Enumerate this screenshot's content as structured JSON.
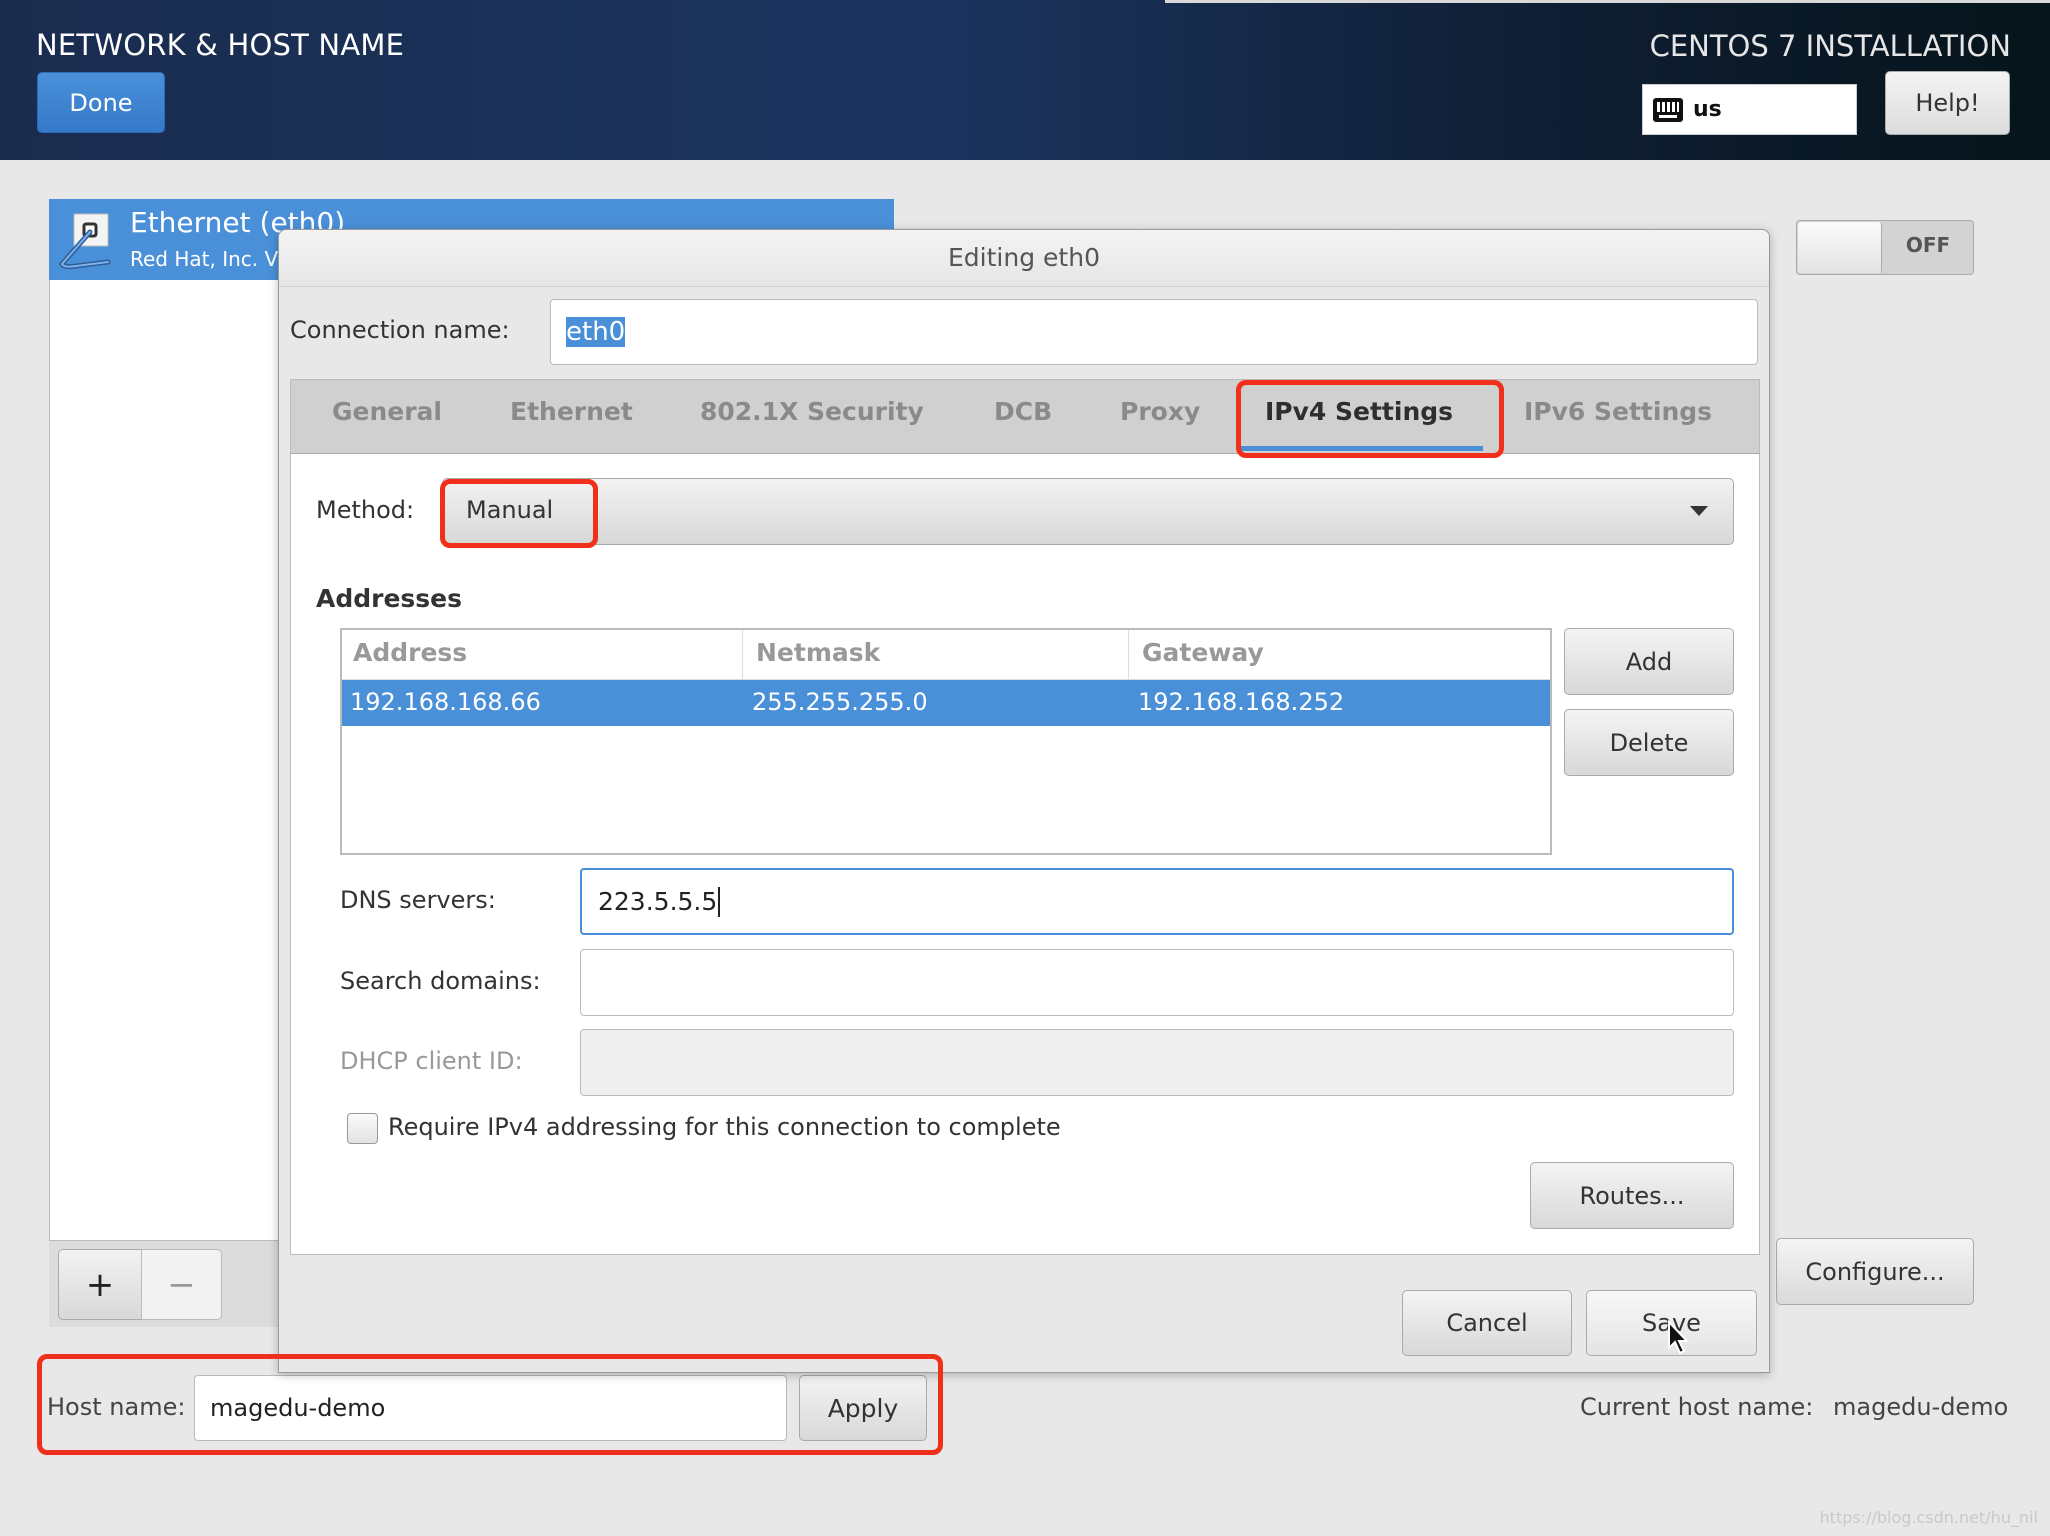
{
  "header": {
    "spoke_title": "NETWORK & HOST NAME",
    "done_label": "Done",
    "product_title": "CENTOS 7 INSTALLATION",
    "keyboard_layout": "us",
    "help_label": "Help!"
  },
  "devices": {
    "items": [
      {
        "title": "Ethernet (eth0)",
        "subtitle": "Red Hat, Inc. Virtio network device",
        "icon": "ethernet-cable-icon",
        "selected": true
      }
    ],
    "add_label": "+",
    "remove_label": "−"
  },
  "device_toggle": {
    "state": "OFF"
  },
  "configure_label": "Configure...",
  "hostname": {
    "label": "Host name:",
    "value": "magedu-demo",
    "apply_label": "Apply",
    "current_label": "Current host name:",
    "current_value": "magedu-demo"
  },
  "dialog": {
    "title": "Editing eth0",
    "connection_name_label": "Connection name:",
    "connection_name_value": "eth0",
    "tabs": [
      {
        "label": "General",
        "active": false
      },
      {
        "label": "Ethernet",
        "active": false
      },
      {
        "label": "802.1X Security",
        "active": false
      },
      {
        "label": "DCB",
        "active": false
      },
      {
        "label": "Proxy",
        "active": false
      },
      {
        "label": "IPv4 Settings",
        "active": true
      },
      {
        "label": "IPv6 Settings",
        "active": false
      }
    ],
    "method_label": "Method:",
    "method_value": "Manual",
    "addresses_heading": "Addresses",
    "addresses_columns": [
      "Address",
      "Netmask",
      "Gateway"
    ],
    "addresses_rows": [
      [
        "192.168.168.66",
        "255.255.255.0",
        "192.168.168.252"
      ]
    ],
    "add_label": "Add",
    "delete_label": "Delete",
    "dns_label": "DNS servers:",
    "dns_value": "223.5.5.5",
    "search_label": "Search domains:",
    "search_value": "",
    "dhcp_label": "DHCP client ID:",
    "dhcp_value": "",
    "require_ipv4_label": "Require IPv4 addressing for this connection to complete",
    "require_ipv4_checked": false,
    "routes_label": "Routes...",
    "cancel_label": "Cancel",
    "save_label": "Save"
  },
  "accent_color": "#4a90d9",
  "annotation_color": "#f0301a",
  "watermark": "https://blog.csdn.net/hu_nil"
}
